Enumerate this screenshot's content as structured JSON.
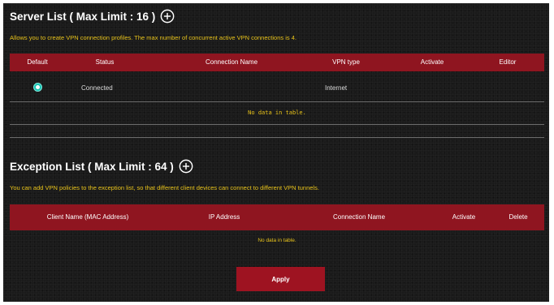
{
  "server_list": {
    "title": "Server List ( Max Limit : 16 )",
    "description": "Allows you to create VPN connection profiles. The max number of concurrent active VPN connections is 4.",
    "columns": [
      "Default",
      "Status",
      "Connection Name",
      "VPN type",
      "Activate",
      "Editor"
    ],
    "rows": [
      {
        "status": "Connected",
        "connection_name": "",
        "vpn_type": "Internet",
        "default_selected": true
      }
    ],
    "no_data": "No data in table."
  },
  "exception_list": {
    "title": "Exception List ( Max Limit : 64 )",
    "description": "You can add VPN policies to the exception list, so that different client devices can connect to different VPN tunnels.",
    "columns": [
      "Client Name (MAC Address)",
      "IP Address",
      "Connection Name",
      "Activate",
      "Delete"
    ],
    "no_data": "No data in table."
  },
  "apply_label": "Apply",
  "colors": {
    "background": "#1a1a1a",
    "header_red": "#8f1520",
    "button_red": "#9e1321",
    "accent_yellow": "#e7c21a",
    "radio_teal": "#19c4b3"
  },
  "icons": {
    "add": "plus-circle-icon",
    "radio": "radio-selected-icon"
  }
}
